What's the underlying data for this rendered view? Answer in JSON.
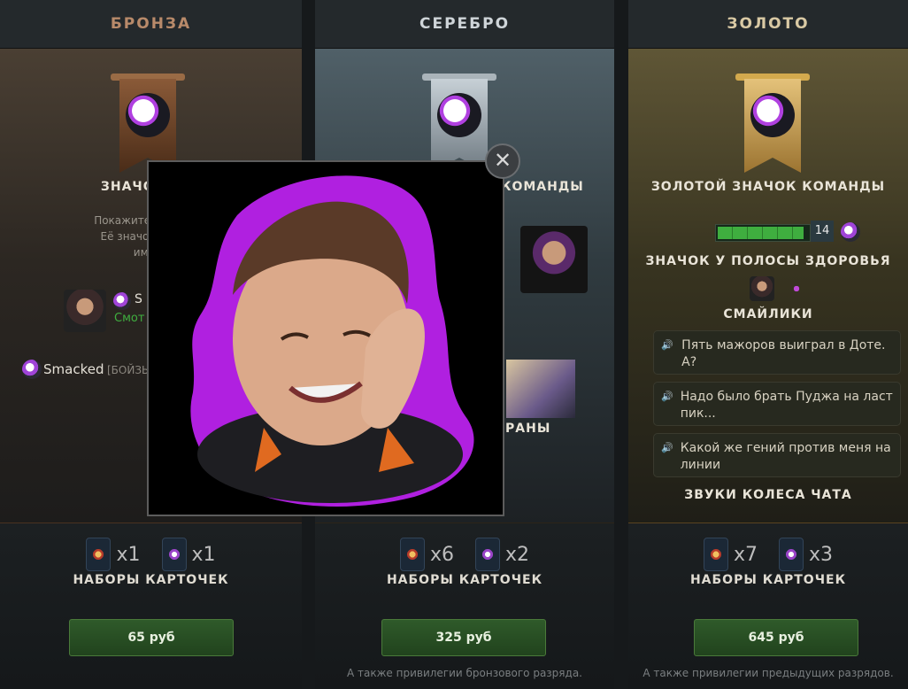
{
  "tiers": [
    {
      "header": "БРОНЗА",
      "badge_title_partial": "ЗНАЧОК",
      "desc_lines": [
        "Покажите, что подд",
        "Её значок будет в",
        "имене"
      ],
      "player_tag_partial": "S",
      "player_status_partial": "Смот",
      "chat_name": "Smacked",
      "chat_tag_partial": "[БОЙЗЫ",
      "card_counts": [
        "x1",
        "x1"
      ],
      "cards_label": "НАБОРЫ КАРТОЧЕК",
      "price": "65 руб",
      "note": ""
    },
    {
      "header": "СЕРЕБРО",
      "badge_title_partial": "КОМАНДЫ",
      "screens_label_partial": "РАНЫ",
      "card_counts": [
        "x6",
        "x2"
      ],
      "cards_label": "НАБОРЫ КАРТОЧЕК",
      "price": "325 руб",
      "note": "А также привилегии бронзового разряда."
    },
    {
      "header": "ЗОЛОТО",
      "badge_title": "ЗОЛОТОЙ ЗНАЧОК КОМАНДЫ",
      "health_level": "14",
      "health_fill_fraction": 0.95,
      "healthbar_label": "ЗНАЧОК У ПОЛОСЫ ЗДОРОВЬЯ",
      "emoticons_label": "СМАЙЛИКИ",
      "chat_sounds": [
        "Пять мажоров выиграл в Доте. А?",
        "Надо было брать Пуджа на ласт пик...",
        "Какой же гений против меня на линии"
      ],
      "chat_wheel_label": "ЗВУКИ КОЛЕСА ЧАТА",
      "card_counts": [
        "x7",
        "x3"
      ],
      "cards_label": "НАБОРЫ КАРТОЧЕК",
      "price": "645 руб",
      "note": "А также привилегии предыдущих разрядов."
    }
  ],
  "popup": {
    "close_glyph": "✕"
  },
  "icons": {
    "speaker": "speaker-icon",
    "close": "close-icon"
  },
  "colors": {
    "bronze": "#b88a6a",
    "silver": "#cfd5d9",
    "gold": "#d9c9a4",
    "buy_button": "#2f5a2a",
    "health": "#3fae3f",
    "emoticon_purple": "#b040e0"
  }
}
